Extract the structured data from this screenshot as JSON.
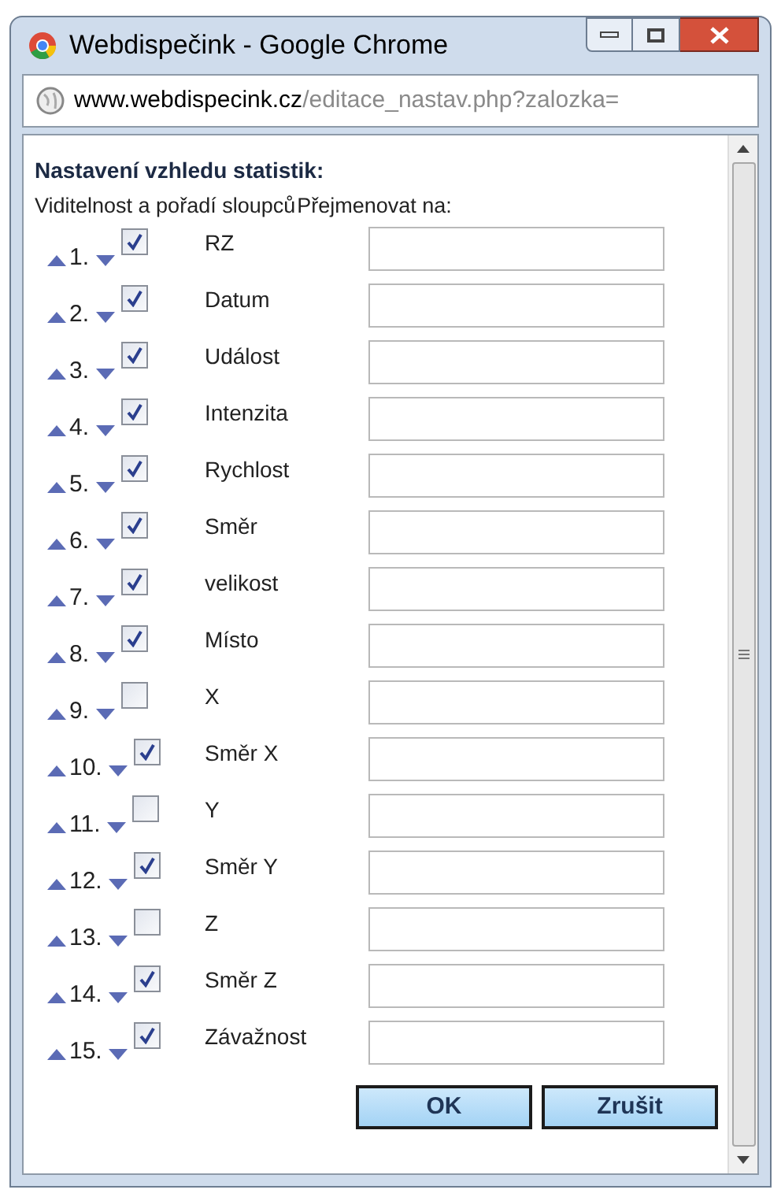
{
  "window": {
    "title": "Webdispečink - Google Chrome"
  },
  "address_bar": {
    "domain": "www.webdispecink.cz",
    "path": "/editace_nastav.php?zalozka="
  },
  "heading": "Nastavení vzhledu statistik:",
  "columns": [
    "Viditelnost a pořadí sloupců",
    "Přejmenovat na:"
  ],
  "rows": [
    {
      "number": "1.",
      "label": "RZ",
      "checked": true
    },
    {
      "number": "2.",
      "label": "Datum",
      "checked": true
    },
    {
      "number": "3.",
      "label": "Událost",
      "checked": true
    },
    {
      "number": "4.",
      "label": "Intenzita",
      "checked": true
    },
    {
      "number": "5.",
      "label": "Rychlost",
      "checked": true
    },
    {
      "number": "6.",
      "label": "Směr",
      "checked": true
    },
    {
      "number": "7.",
      "label": "velikost",
      "checked": true
    },
    {
      "number": "8.",
      "label": "Místo",
      "checked": true
    },
    {
      "number": "9.",
      "label": "X",
      "checked": false
    },
    {
      "number": "10.",
      "label": "Směr X",
      "checked": true
    },
    {
      "number": "11.",
      "label": "Y",
      "checked": false
    },
    {
      "number": "12.",
      "label": "Směr Y",
      "checked": true
    },
    {
      "number": "13.",
      "label": "Z",
      "checked": false
    },
    {
      "number": "14.",
      "label": "Směr Z",
      "checked": true
    },
    {
      "number": "15.",
      "label": "Závažnost",
      "checked": true
    }
  ],
  "buttons": [
    "OK",
    "Zrušit"
  ]
}
